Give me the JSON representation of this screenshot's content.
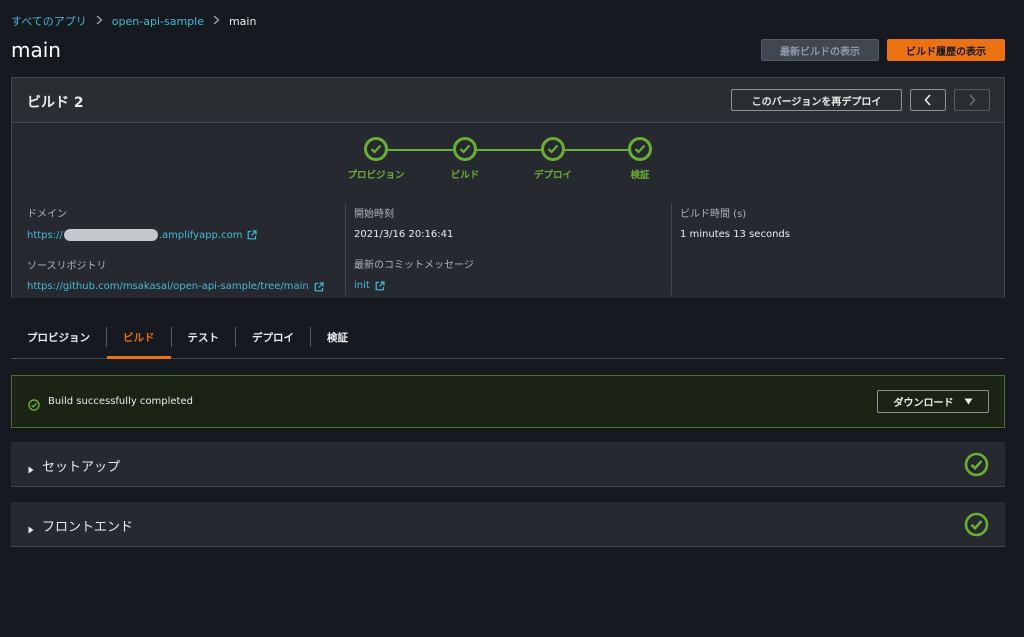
{
  "breadcrumb": {
    "items": [
      "すべてのアプリ",
      "open-api-sample"
    ],
    "current": "main"
  },
  "page": {
    "title": "main",
    "view_latest_label": "最新ビルドの表示",
    "view_history_label": "ビルド履歴の表示"
  },
  "build": {
    "title": "ビルド 2",
    "redeploy_label": "このバージョンを再デプロイ",
    "prev_glyph": "‹",
    "next_glyph": "›",
    "steps": [
      "プロビジョン",
      "ビルド",
      "デプロイ",
      "検証"
    ],
    "domain_label": "ドメイン",
    "domain_prefix": "https://",
    "domain_suffix": ".amplifyapp.com",
    "repo_label": "ソースリポジトリ",
    "repo_url": "https://github.com/msakasai/open-api-sample/tree/main",
    "start_label": "開始時刻",
    "start_value": "2021/3/16 20:16:41",
    "commit_label": "最新のコミットメッセージ",
    "commit_value": "init",
    "duration_label": "ビルド時間 (s)",
    "duration_value": "1 minutes 13 seconds"
  },
  "tabs": [
    {
      "label": "プロビジョン",
      "active": false
    },
    {
      "label": "ビルド",
      "active": true
    },
    {
      "label": "テスト",
      "active": false
    },
    {
      "label": "デプロイ",
      "active": false
    },
    {
      "label": "検証",
      "active": false
    }
  ],
  "alert": {
    "message": "Build successfully completed",
    "download_label": "ダウンロード"
  },
  "sections": [
    {
      "title": "セットアップ",
      "status": "success"
    },
    {
      "title": "フロントエンド",
      "status": "success"
    }
  ],
  "colors": {
    "accent": "#ec7211",
    "success": "#6aaf35",
    "link": "#44b9d6",
    "background": "#16191f"
  }
}
